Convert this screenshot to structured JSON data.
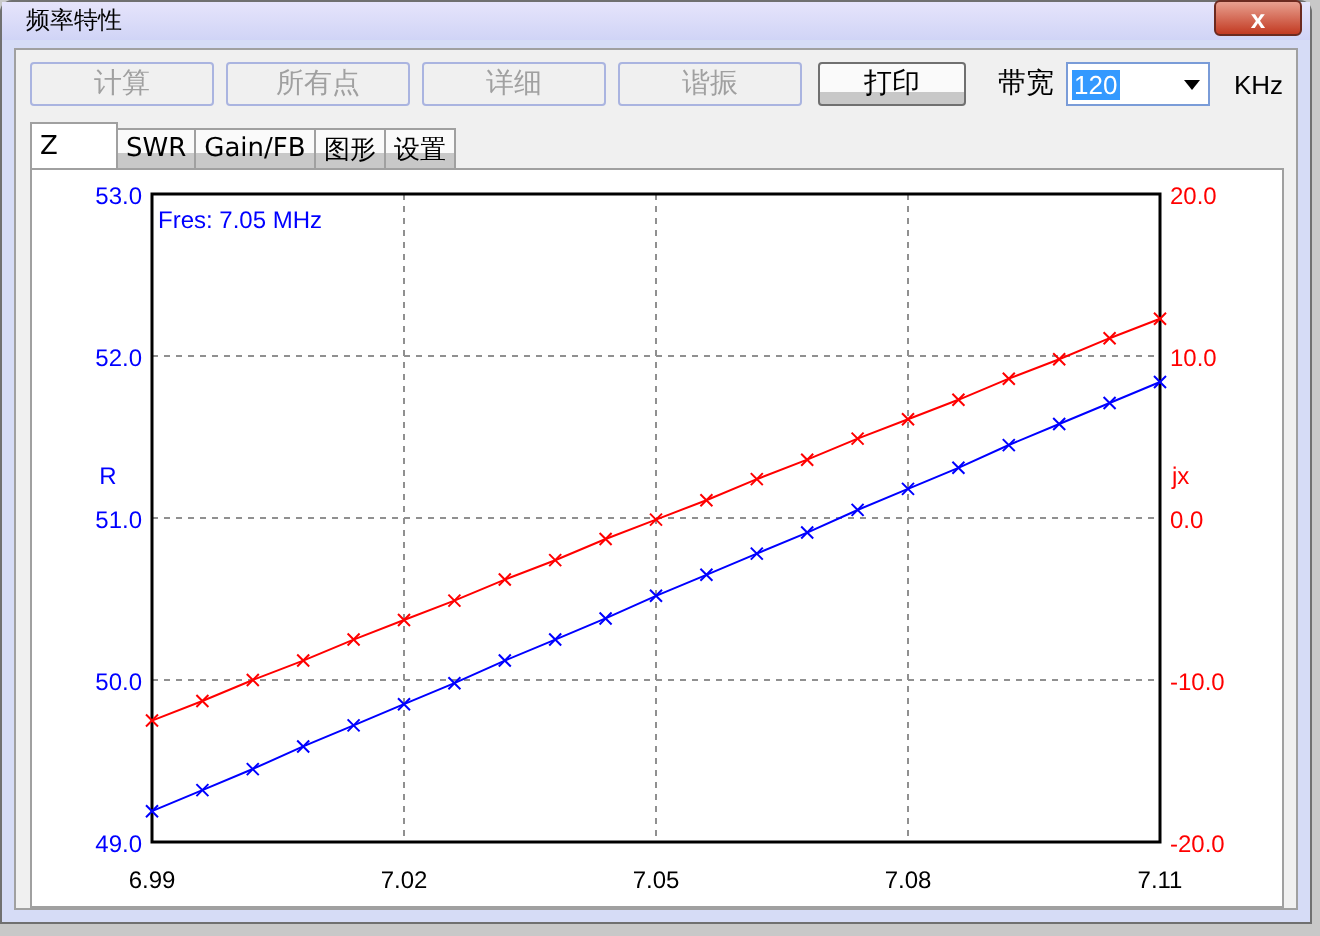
{
  "window": {
    "title": "频率特性",
    "close": "x"
  },
  "toolbar": {
    "buttons": [
      {
        "label": "计算",
        "disabled": true
      },
      {
        "label": "所有点",
        "disabled": true
      },
      {
        "label": "详细",
        "disabled": true
      },
      {
        "label": "谐振",
        "disabled": true
      },
      {
        "label": "打印",
        "disabled": false
      }
    ],
    "bandwidth": {
      "label": "带宽",
      "value": "120",
      "unit": "KHz"
    }
  },
  "tabs": [
    {
      "label": "Z",
      "selected": true
    },
    {
      "label": "SWR",
      "selected": false
    },
    {
      "label": "Gain/FB",
      "selected": false
    },
    {
      "label": "图形",
      "selected": false
    },
    {
      "label": "设置",
      "selected": false
    }
  ],
  "chart_data": {
    "type": "line",
    "grid": true,
    "annotations": [
      "Fres: 7.05 MHz"
    ],
    "xlim": [
      6.99,
      7.11
    ],
    "ylim": [
      49,
      53
    ],
    "y2lim": [
      -20,
      20
    ],
    "xticks": [
      {
        "value": 6.99,
        "label": "6.99"
      },
      {
        "value": 7.02,
        "label": "7.02"
      },
      {
        "value": 7.05,
        "label": "7.05"
      },
      {
        "value": 7.08,
        "label": "7.08"
      },
      {
        "value": 7.11,
        "label": "7.11"
      }
    ],
    "yticks": [
      {
        "value": 49,
        "label": "49.0"
      },
      {
        "value": 50,
        "label": "50.0"
      },
      {
        "value": 51,
        "label": "51.0"
      },
      {
        "value": 52,
        "label": "52.0"
      },
      {
        "value": 53,
        "label": "53.0"
      }
    ],
    "y2ticks": [
      {
        "value": -20,
        "label": "-20.0"
      },
      {
        "value": -10,
        "label": "-10.0"
      },
      {
        "value": 0,
        "label": "0.0"
      },
      {
        "value": 10,
        "label": "10.0"
      },
      {
        "value": 20,
        "label": "20.0"
      }
    ],
    "x": [
      6.99,
      6.996,
      7.002,
      7.008,
      7.014,
      7.02,
      7.026,
      7.032,
      7.038,
      7.044,
      7.05,
      7.056,
      7.062,
      7.068,
      7.074,
      7.08,
      7.086,
      7.092,
      7.098,
      7.104,
      7.11
    ],
    "series": [
      {
        "name": "R",
        "color": "#0000ff",
        "marker": "x",
        "values": [
          49.19,
          49.32,
          49.45,
          49.59,
          49.72,
          49.85,
          49.98,
          50.12,
          50.25,
          50.38,
          50.52,
          50.65,
          50.78,
          50.91,
          51.05,
          51.18,
          51.31,
          51.45,
          51.58,
          51.71,
          51.84
        ]
      },
      {
        "name": "jx",
        "color": "#ff0000",
        "axis": "y2",
        "marker": "x",
        "values": [
          -12.5,
          -11.3,
          -10.0,
          -8.8,
          -7.5,
          -6.3,
          -5.1,
          -3.8,
          -2.6,
          -1.3,
          -0.1,
          1.1,
          2.4,
          3.6,
          4.9,
          6.1,
          7.3,
          8.6,
          9.8,
          11.1,
          12.3
        ]
      }
    ]
  }
}
